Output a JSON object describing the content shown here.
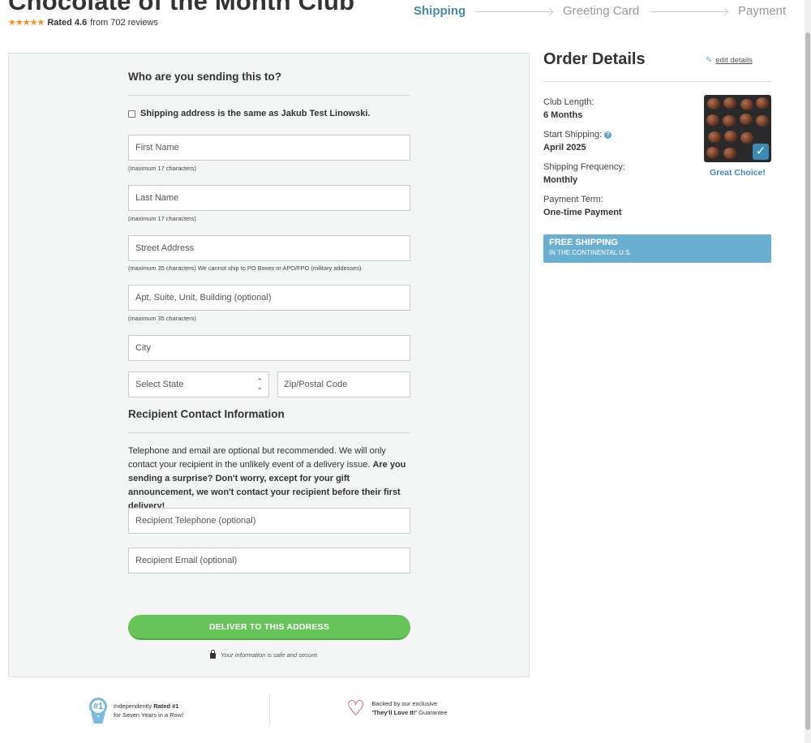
{
  "product": {
    "title": "Chocolate of the Month Club",
    "stars": "★★★★★",
    "rating_label": "Rated 4.6",
    "rating_suffix": "from 702 reviews"
  },
  "steps": [
    "Shipping",
    "Greeting Card",
    "Payment"
  ],
  "form": {
    "heading": "Who are you sending this to?",
    "same_address_label": "Shipping address is the same as Jakub Test Linowski.",
    "first_name_placeholder": "First Name",
    "first_name_hint": "(maximum 17 characters)",
    "last_name_placeholder": "Last Name",
    "last_name_hint": "(maximum 17 characters)",
    "street_placeholder": "Street Address",
    "street_hint": "(maximum 35 characters) We cannot ship to PO Boxes or APO/FPO (military addesses)",
    "apt_placeholder": "Apt, Suite, Unit, Building (optional)",
    "apt_hint": "(maximum 35 characters)",
    "city_placeholder": "City",
    "state_selected": "Select State",
    "zip_placeholder": "Zip/Postal Code",
    "contact_heading": "Recipient Contact Information",
    "contact_info_normal": "Telephone and email are optional but recommended. We will only contact your recipient in the unlikely event of a delivery issue. ",
    "contact_info_bold": "Are you sending a surprise? Don't worry, except for your gift announcement, we won't contact your recipient before their first delivery!",
    "phone_placeholder": "Recipient Telephone (optional)",
    "email_placeholder": "Recipient Email (optional)",
    "submit_label": "DELIVER TO THIS ADDRESS",
    "secure_note": "Your information is safe and secure."
  },
  "order": {
    "title": "Order Details",
    "edit_label": "edit details",
    "club_length_label": "Club Length:",
    "club_length_value": "6 Months",
    "start_label": "Start Shipping:",
    "start_value": "April 2025",
    "frequency_label": "Shipping Frequency:",
    "frequency_value": "Monthly",
    "term_label": "Payment Term:",
    "term_value": "One-time Payment",
    "choice_label": "Great Choice!",
    "shipping_banner": "FREE SHIPPING",
    "shipping_sub": "IN THE CONTINENTAL U.S."
  },
  "footer": {
    "badge1_pre": "Independently ",
    "badge1_bold": "Rated #1",
    "badge1_line2": "for Seven Years in a Row!",
    "badge1_icon_text": "#1",
    "badge2_line1": "Backed by our exclusive",
    "badge2_bold": "'They'll Love It!'",
    "badge2_post": " Guarantee"
  },
  "colors": {
    "accent_blue": "#4a8aa6",
    "submit_green": "#67c45a",
    "banner_blue": "#6bafd0",
    "star_orange": "#f0901e",
    "heart_red": "#c6202c"
  }
}
